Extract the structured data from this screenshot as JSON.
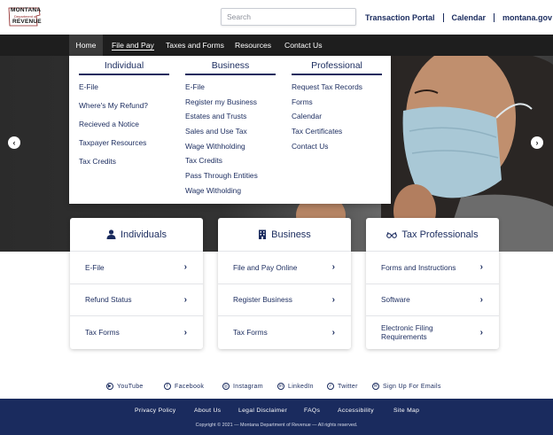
{
  "logo": {
    "line1": "MONTANA",
    "line2": "Department of",
    "line3": "REVENUE"
  },
  "search": {
    "placeholder": "Search"
  },
  "top_links": [
    "Transaction Portal",
    "Calendar",
    "montana.gov"
  ],
  "nav": [
    "Home",
    "File and Pay",
    "Taxes and Forms",
    "Resources",
    "Contact Us"
  ],
  "dropdown": {
    "individual": {
      "title": "Individual",
      "links": [
        "E-File",
        "Where's My Refund?",
        "Recieved a Notice",
        "Taxpayer Resources",
        "Tax Credits"
      ]
    },
    "business": {
      "title": "Business",
      "links": [
        "E-File",
        "Register my Business",
        "Estates and Trusts",
        "Sales and Use Tax",
        "Wage Withholding",
        "Tax Credits",
        "Pass Through Entities",
        "Wage Witholding"
      ]
    },
    "professional": {
      "title": "Professional",
      "links": [
        "Request Tax Records",
        "Forms",
        "Calendar",
        "Tax Certificates",
        "Contact Us"
      ]
    }
  },
  "cards": {
    "individuals": {
      "title": "Individuals",
      "icon": "person-icon",
      "rows": [
        "E-File",
        "Refund Status",
        "Tax Forms"
      ]
    },
    "business": {
      "title": "Business",
      "icon": "building-icon",
      "rows": [
        "File and Pay Online",
        "Register Business",
        "Tax Forms"
      ]
    },
    "professionals": {
      "title": "Tax Professionals",
      "icon": "glasses-icon",
      "rows": [
        "Forms and Instructions",
        "Software",
        "Electronic Filing Requirements"
      ]
    }
  },
  "social": [
    "YouTube",
    "Facebook",
    "Instagram",
    "LinkedIn",
    "Twitter",
    "Sign Up For Emails"
  ],
  "footer": {
    "links": [
      "Privacy Policy",
      "About Us",
      "Legal Disclaimer",
      "FAQs",
      "Accessibility",
      "Site Map"
    ],
    "copyright": "Copyright © 2021 — Montana Department of Revenue — All rights reserved."
  },
  "colors": {
    "navy": "#1a2b5e",
    "nav_bg": "#1e1e1e",
    "footer_bg": "#1a2b5e"
  }
}
